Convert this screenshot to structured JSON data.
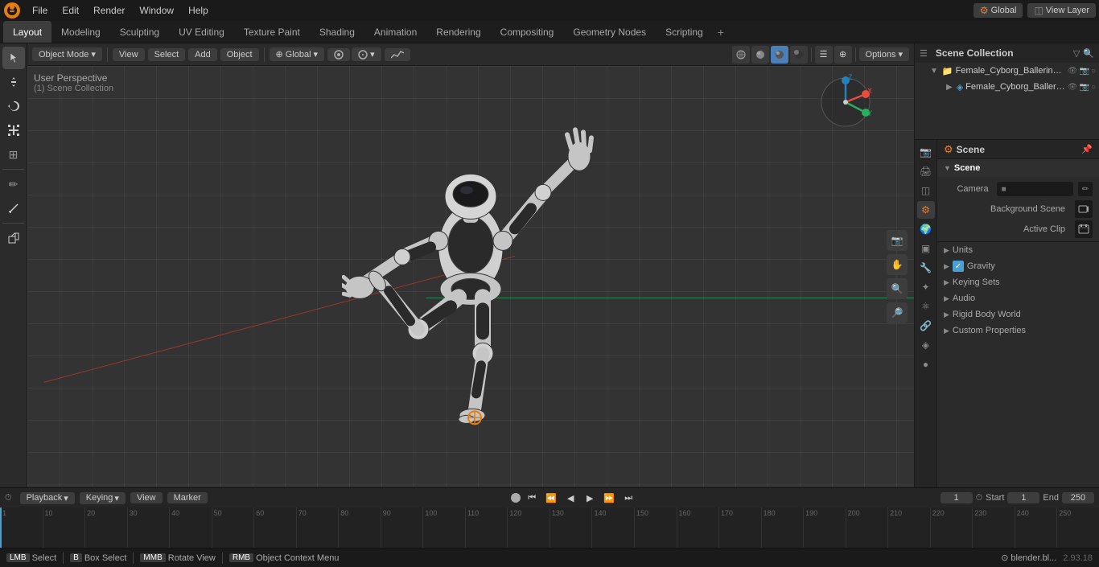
{
  "menubar": {
    "items": [
      "File",
      "Edit",
      "Render",
      "Window",
      "Help"
    ],
    "app_name": "Blender"
  },
  "workspace_tabs": {
    "tabs": [
      "Layout",
      "Modeling",
      "Sculpting",
      "UV Editing",
      "Texture Paint",
      "Shading",
      "Animation",
      "Rendering",
      "Compositing",
      "Geometry Nodes",
      "Scripting"
    ],
    "active": "Layout",
    "add_label": "+"
  },
  "viewport": {
    "mode_label": "Object Mode",
    "view_label": "View",
    "select_label": "Select",
    "add_label": "Add",
    "object_label": "Object",
    "shading_label": "Global",
    "info_perspective": "User Perspective",
    "info_collection": "(1) Scene Collection",
    "options_label": "Options"
  },
  "outliner": {
    "title": "Scene Collection",
    "search_placeholder": "",
    "items": [
      {
        "label": "Female_Cyborg_Ballerina_Po",
        "depth": 1,
        "icon": "📁",
        "visible": true
      },
      {
        "label": "Female_Cyborg_Ballerina",
        "depth": 2,
        "icon": "🔷",
        "visible": true
      }
    ]
  },
  "properties": {
    "search_placeholder": "",
    "active_tab": "scene",
    "scene_label": "Scene",
    "sections": {
      "scene": {
        "title": "Scene",
        "camera_label": "Camera",
        "camera_value": "",
        "background_scene_label": "Background Scene",
        "active_clip_label": "Active Clip"
      },
      "units": {
        "title": "Units"
      },
      "gravity": {
        "title": "Gravity",
        "enabled": true
      },
      "keying_sets": {
        "title": "Keying Sets"
      },
      "audio": {
        "title": "Audio"
      },
      "rigid_body_world": {
        "title": "Rigid Body World"
      },
      "custom_properties": {
        "title": "Custom Properties"
      }
    }
  },
  "timeline": {
    "playback_label": "Playback",
    "keying_label": "Keying",
    "view_label": "View",
    "marker_label": "Marker",
    "current_frame": "1",
    "start_frame": "1",
    "end_frame": "250",
    "start_label": "Start",
    "end_label": "End",
    "ruler_marks": [
      "1",
      "10",
      "20",
      "30",
      "40",
      "50",
      "60",
      "70",
      "80",
      "90",
      "100",
      "110",
      "120",
      "130",
      "140",
      "150",
      "160",
      "170",
      "180",
      "190",
      "200",
      "210",
      "220",
      "230",
      "240",
      "250"
    ]
  },
  "statusbar": {
    "select_key": "Select",
    "select_action": "",
    "box_select_key": "Box Select",
    "rotate_key": "Rotate View",
    "context_menu_key": "Object Context Menu",
    "blender_file": "blender.bl...",
    "version": "2.93.18"
  },
  "icons": {
    "cursor": "⊕",
    "move": "✛",
    "rotate": "↺",
    "scale": "⤢",
    "transform": "⊞",
    "annotate": "✏",
    "measure": "📐",
    "add_cube": "⬜",
    "scene": "🎬",
    "render": "📷",
    "output": "🖨",
    "view_layer": "👁",
    "world": "🌍",
    "object": "▣",
    "modifier": "🔧",
    "particles": "✦",
    "physics": "⚛",
    "constraints": "🔗",
    "data": "◈",
    "material": "●",
    "chevron": "▶",
    "eye": "👁",
    "camera": "📷",
    "restrict": "🚫",
    "filter": "⊞",
    "funnel": "▽"
  }
}
